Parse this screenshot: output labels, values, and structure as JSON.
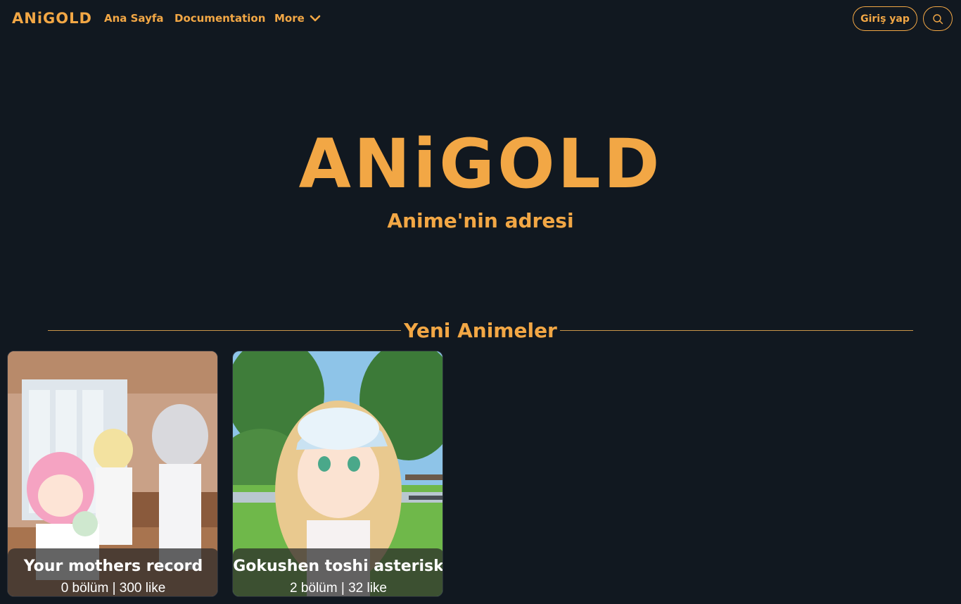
{
  "navbar": {
    "brand": "ANiGOLD",
    "links": [
      {
        "label": "Ana Sayfa"
      },
      {
        "label": "Documentation"
      },
      {
        "label": "More"
      }
    ],
    "login_label": "Giriş yap",
    "search_icon": "search-icon",
    "more_icon": "chevron-down-icon"
  },
  "hero": {
    "logo": "ANiGOLD",
    "subtitle": "Anime'nin adresi"
  },
  "section": {
    "title": "Yeni Animeler"
  },
  "cards": [
    {
      "title": "Your mothers record",
      "meta": "0 bölüm | 300 like"
    },
    {
      "title": "Gokushen toshi asterisk",
      "meta": "2 bölüm | 32 like"
    }
  ],
  "colors": {
    "background": "#111820",
    "accent": "#f2a745",
    "divider": "#c9964a"
  }
}
